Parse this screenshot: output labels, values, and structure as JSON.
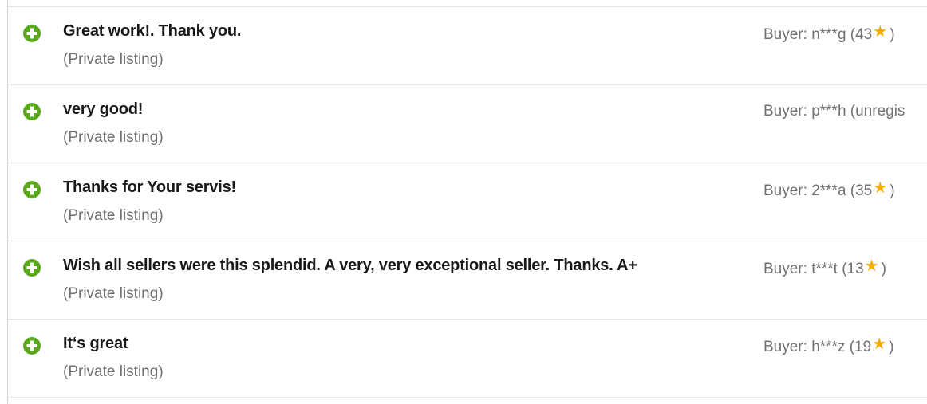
{
  "colors": {
    "positive_icon": "#5ba71b",
    "star": "#f2a900",
    "comment_text": "#191919",
    "secondary_text": "#707070",
    "divider": "#e5e5e5"
  },
  "feedback": [
    {
      "rating_icon": "plus-circle-icon",
      "comment": "Great work!. Thank you.",
      "listing": "(Private listing)",
      "buyer_prefix": "Buyer: n***g (43",
      "star": "★",
      "buyer_suffix": ")"
    },
    {
      "rating_icon": "plus-circle-icon",
      "comment": "very good!",
      "listing": "(Private listing)",
      "buyer_prefix": "Buyer: p***h (unregis",
      "star": "",
      "buyer_suffix": ""
    },
    {
      "rating_icon": "plus-circle-icon",
      "comment": "Thanks for Your servis!",
      "listing": "(Private listing)",
      "buyer_prefix": "Buyer: 2***a (35",
      "star": "★",
      "buyer_suffix": ")"
    },
    {
      "rating_icon": "plus-circle-icon",
      "comment": "Wish all sellers were this splendid. A very, very exceptional seller. Thanks. A+",
      "listing": "(Private listing)",
      "buyer_prefix": "Buyer: t***t (13",
      "star": "★",
      "buyer_suffix": ")"
    },
    {
      "rating_icon": "plus-circle-icon",
      "comment": "It‘s great",
      "listing": "(Private listing)",
      "buyer_prefix": "Buyer: h***z (19",
      "star": "★",
      "buyer_suffix": ")"
    }
  ]
}
